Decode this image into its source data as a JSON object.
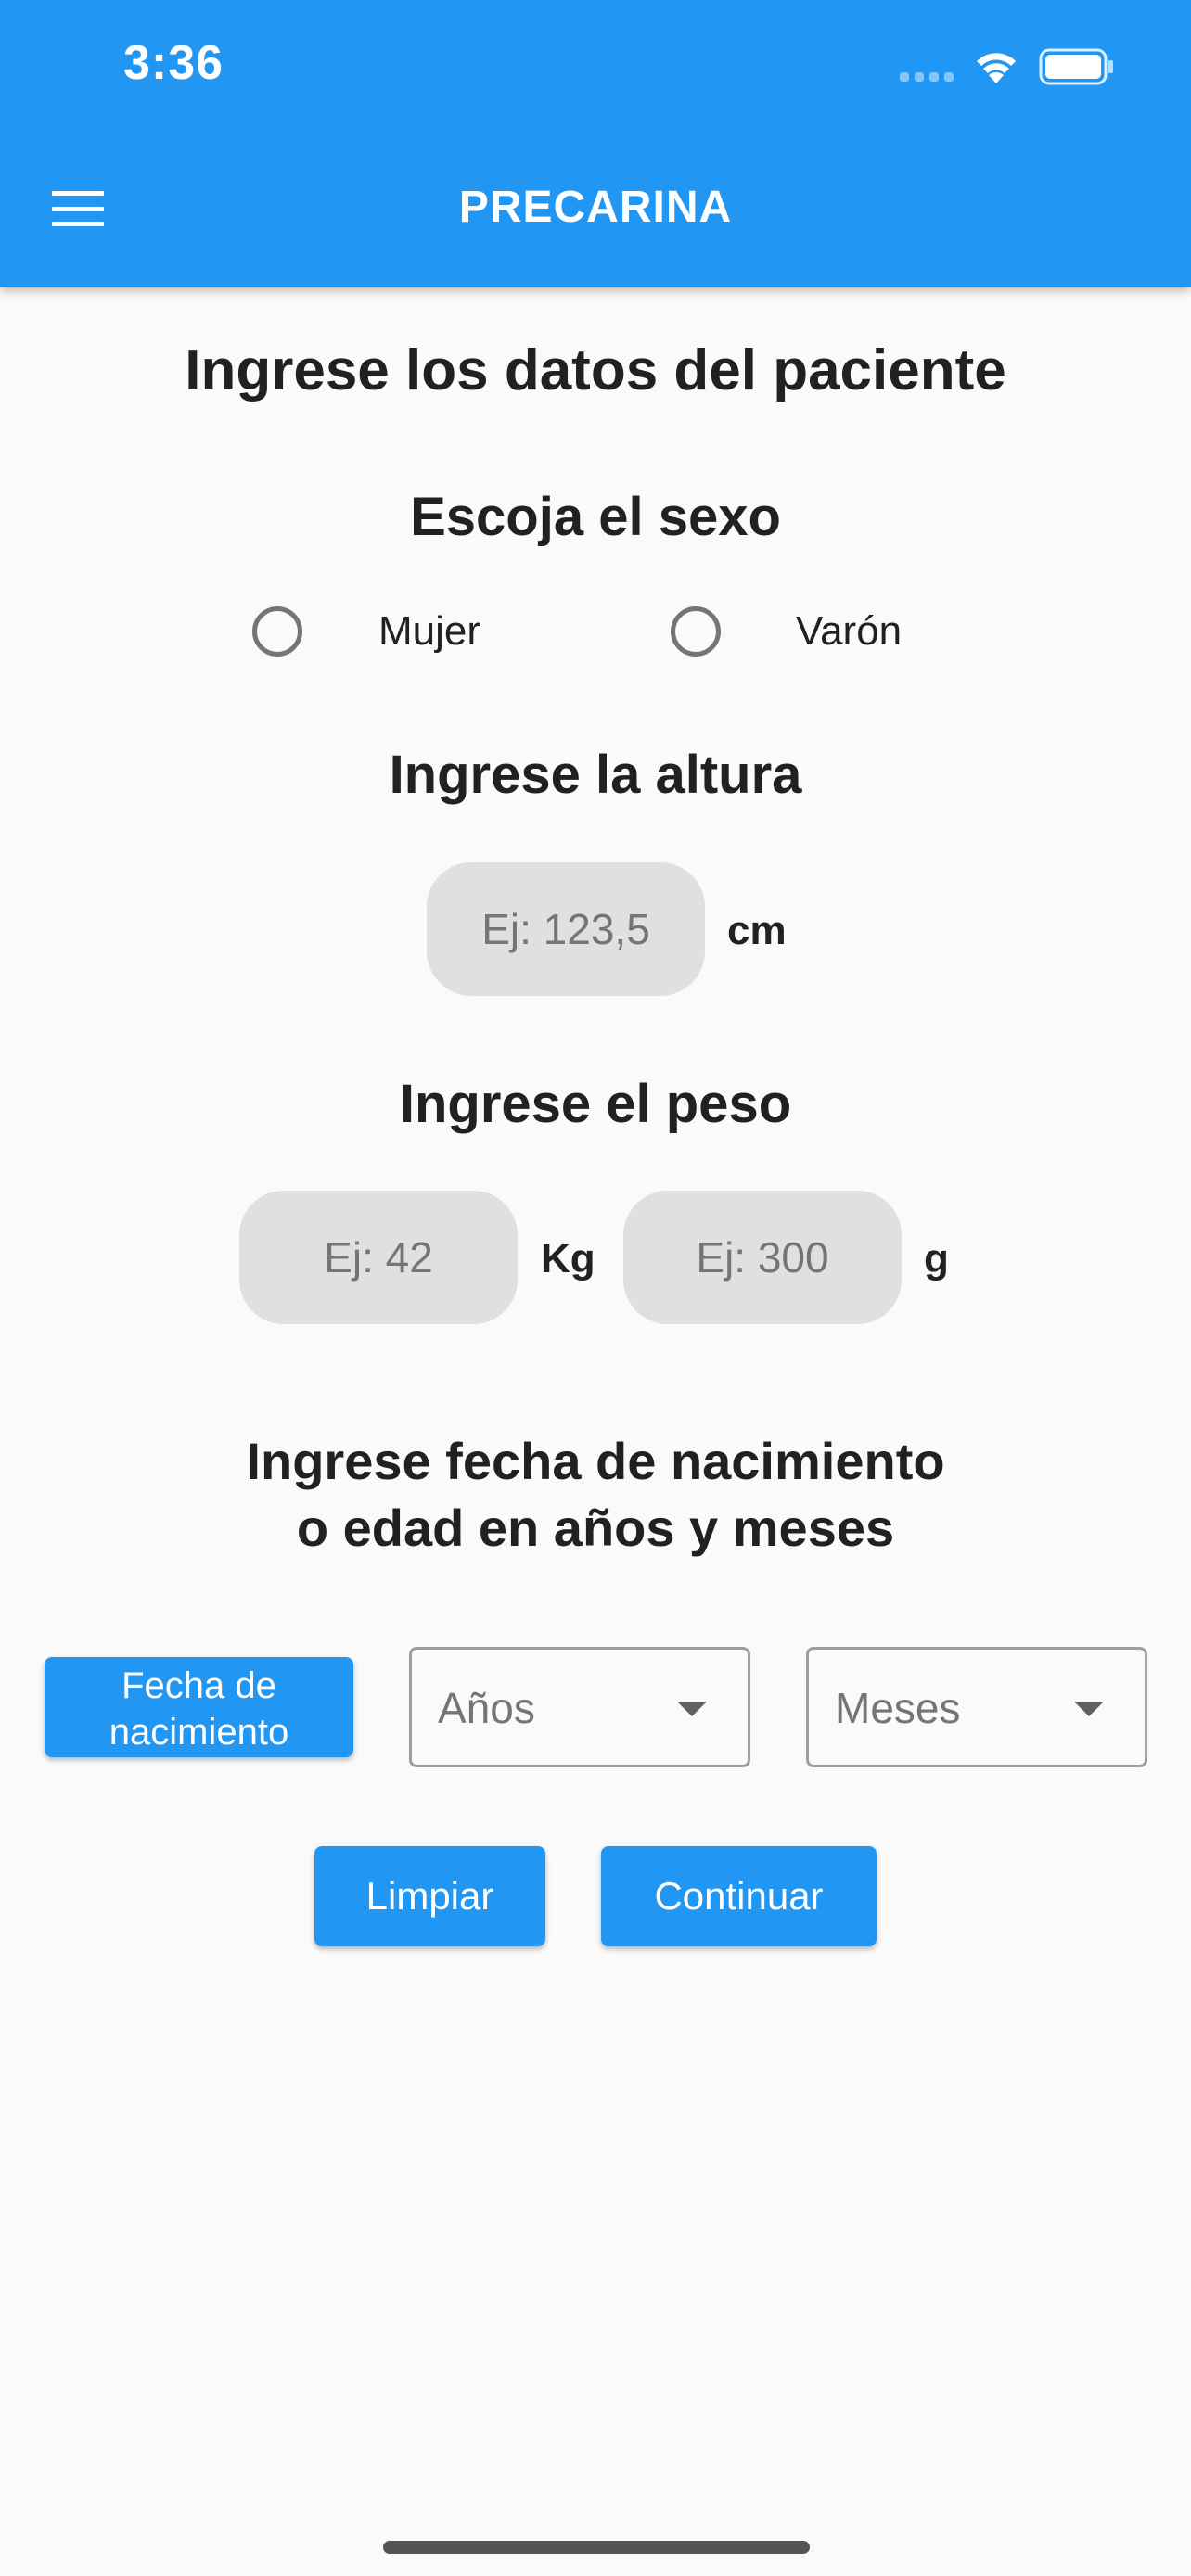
{
  "status_bar": {
    "time": "3:36"
  },
  "app_bar": {
    "title": "PRECARINA"
  },
  "page_title": "Ingrese los datos del paciente",
  "sex": {
    "title": "Escoja el sexo",
    "options": [
      "Mujer",
      "Varón"
    ]
  },
  "height": {
    "title": "Ingrese la altura",
    "placeholder": "Ej: 123,5",
    "unit": "cm"
  },
  "weight": {
    "title": "Ingrese el peso",
    "kg_placeholder": "Ej: 42",
    "kg_unit": "Kg",
    "g_placeholder": "Ej: 300",
    "g_unit": "g"
  },
  "birth": {
    "title_line1": "Ingrese fecha de nacimiento",
    "title_line2": "o edad en años y meses",
    "date_button_line1": "Fecha de",
    "date_button_line2": "nacimiento",
    "years_dropdown": "Años",
    "months_dropdown": "Meses"
  },
  "actions": {
    "clear": "Limpiar",
    "continue": "Continuar"
  },
  "colors": {
    "primary": "#2196f3",
    "input_bg": "#e0e0e0",
    "background": "#fafafa"
  }
}
